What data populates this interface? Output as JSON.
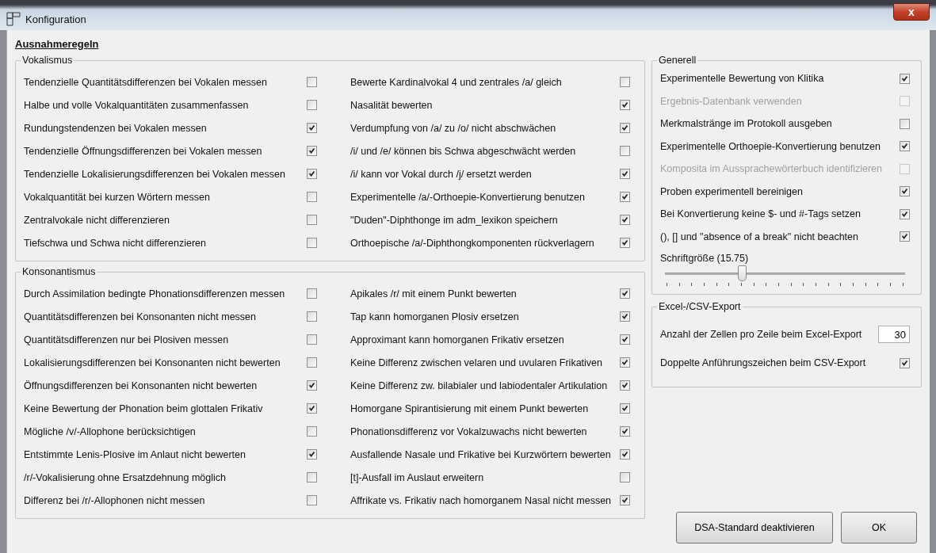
{
  "window": {
    "title": "Konfiguration",
    "close": "x"
  },
  "heading": "Ausnahmeregeln",
  "groups": [
    {
      "title": "Vokalismus",
      "columns": [
        [
          {
            "label": "Tendenzielle Quantitätsdifferenzen bei Vokalen messen",
            "checked": false
          },
          {
            "label": "Halbe und volle Vokalquantitäten zusammenfassen",
            "checked": false
          },
          {
            "label": "Rundungstendenzen bei Vokalen messen",
            "checked": true
          },
          {
            "label": "Tendenzielle Öffnungsdifferenzen bei Vokalen messen",
            "checked": true
          },
          {
            "label": "Tendenzielle Lokalisierungsdifferenzen bei Vokalen messen",
            "checked": true
          },
          {
            "label": "Vokalquantität bei kurzen Wörtern messen",
            "checked": false
          },
          {
            "label": "Zentralvokale nicht differenzieren",
            "checked": false
          },
          {
            "label": "Tiefschwa und Schwa nicht differenzieren",
            "checked": false
          }
        ],
        [
          {
            "label": "Bewerte Kardinalvokal 4 und zentrales /a/ gleich",
            "checked": false
          },
          {
            "label": "Nasalität bewerten",
            "checked": true
          },
          {
            "label": "Verdumpfung von /a/ zu /o/ nicht abschwächen",
            "checked": true
          },
          {
            "label": "/i/ und /e/ können bis Schwa abgeschwächt werden",
            "checked": false
          },
          {
            "label": "/i/ kann vor Vokal durch /j/ ersetzt werden",
            "checked": true
          },
          {
            "label": "Experimentelle /a/-Orthoepie-Konvertierung benutzen",
            "checked": true
          },
          {
            "label": "\"Duden\"-Diphthonge im adm_lexikon speichern",
            "checked": true
          },
          {
            "label": "Orthoepische /a/-Diphthongkomponenten rückverlagern",
            "checked": true
          }
        ]
      ]
    },
    {
      "title": "Konsonantismus",
      "columns": [
        [
          {
            "label": "Durch Assimilation bedingte Phonationsdifferenzen messen",
            "checked": false
          },
          {
            "label": "Quantitätsdifferenzen bei Konsonanten nicht messen",
            "checked": false
          },
          {
            "label": "Quantitätsdifferenzen nur bei Plosiven messen",
            "checked": false
          },
          {
            "label": "Lokalisierungsdifferenzen bei Konsonanten nicht bewerten",
            "checked": false
          },
          {
            "label": "Öffnungsdifferenzen bei Konsonanten nicht bewerten",
            "checked": true
          },
          {
            "label": "Keine Bewertung der Phonation beim glottalen Frikativ",
            "checked": true
          },
          {
            "label": "Mögliche /v/-Allophone berücksichtigen",
            "checked": false
          },
          {
            "label": "Entstimmte Lenis-Plosive im Anlaut nicht bewerten",
            "checked": true
          },
          {
            "label": "/r/-Vokalisierung ohne Ersatzdehnung möglich",
            "checked": false
          },
          {
            "label": "Differenz bei /r/-Allophonen nicht messen",
            "checked": false
          }
        ],
        [
          {
            "label": "Apikales /r/ mit einem Punkt bewerten",
            "checked": true
          },
          {
            "label": "Tap kann homorganen Plosiv ersetzen",
            "checked": true
          },
          {
            "label": "Approximant kann homorganen Frikativ ersetzen",
            "checked": true
          },
          {
            "label": "Keine Differenz zwischen velaren und uvularen Frikativen",
            "checked": true
          },
          {
            "label": "Keine Differenz zw. bilabialer und labiodentaler Artikulation",
            "checked": true
          },
          {
            "label": "Homorgane Spirantisierung mit einem Punkt bewerten",
            "checked": true
          },
          {
            "label": "Phonationsdifferenz vor Vokalzuwachs nicht bewerten",
            "checked": true
          },
          {
            "label": "Ausfallende Nasale und Frikative bei Kurzwörtern bewerten",
            "checked": true
          },
          {
            "label": "[t]-Ausfall im Auslaut erweitern",
            "checked": false
          },
          {
            "label": "Affrikate vs. Frikativ nach homorganem Nasal nicht messen",
            "checked": true
          }
        ]
      ]
    }
  ],
  "generell": {
    "title": "Generell",
    "items": [
      {
        "label": "Experimentelle Bewertung von Klitika",
        "checked": true,
        "disabled": false
      },
      {
        "label": "Ergebnis-Datenbank verwenden",
        "checked": false,
        "disabled": true
      },
      {
        "label": "Merkmalstränge im Protokoll ausgeben",
        "checked": false,
        "disabled": false
      },
      {
        "label": "Experimentelle Orthoepie-Konvertierung benutzen",
        "checked": true,
        "disabled": false
      },
      {
        "label": "Komposita im Aussprachewörterbuch identifizieren",
        "checked": false,
        "disabled": true
      },
      {
        "label": "Proben experimentell bereinigen",
        "checked": true,
        "disabled": false
      },
      {
        "label": "Bei Konvertierung keine $- und #-Tags setzen",
        "checked": true,
        "disabled": false
      },
      {
        "label": "(), [] und \"absence of a break\" nicht beachten",
        "checked": true,
        "disabled": false
      }
    ],
    "slider": {
      "label": "Schriftgröße (15.75)",
      "level": 0.32
    }
  },
  "export": {
    "title": "Excel-/CSV-Export",
    "cells_label": "Anzahl der Zellen pro Zeile beim Excel-Export",
    "cells_value": "30",
    "quotes_label": "Doppelte Anführungszeichen beim CSV-Export",
    "quotes_checked": true
  },
  "buttons": [
    "DSA-Standard deaktivieren",
    "OK"
  ]
}
